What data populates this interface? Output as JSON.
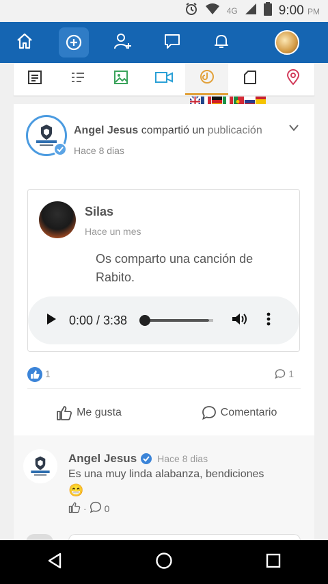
{
  "status_bar": {
    "network": "4G",
    "time": "9:00",
    "ampm": "PM"
  },
  "app_bar": {
    "icons": [
      "home-icon",
      "add-circle-icon",
      "add-user-icon",
      "chat-icon",
      "bell-icon"
    ]
  },
  "tabs": [
    "text-tab",
    "list-tab",
    "image-tab",
    "video-tab",
    "audio-tab",
    "document-tab",
    "location-tab"
  ],
  "post": {
    "author": "Angel Jesus",
    "action": "compartió un",
    "object": "publicación",
    "time": "Hace 8 dias",
    "shared": {
      "author": "Silas",
      "time": "Hace un mes",
      "text": "Os comparto una canción de Rabito.",
      "audio": {
        "time": "0:00 / 3:38",
        "progress": 0
      }
    },
    "likes": "1",
    "comments": "1",
    "like_label": "Me gusta",
    "comment_label": "Comentario"
  },
  "comment": {
    "author": "Angel Jesus",
    "time": "Hace 8 dias",
    "text": "Es una muy linda alabanza, bendiciones",
    "emoji": "😁",
    "separator": "·",
    "count": "0"
  },
  "colors": {
    "primary": "#1565b2",
    "accent": "#e2a13a",
    "like": "#3b84d8"
  }
}
